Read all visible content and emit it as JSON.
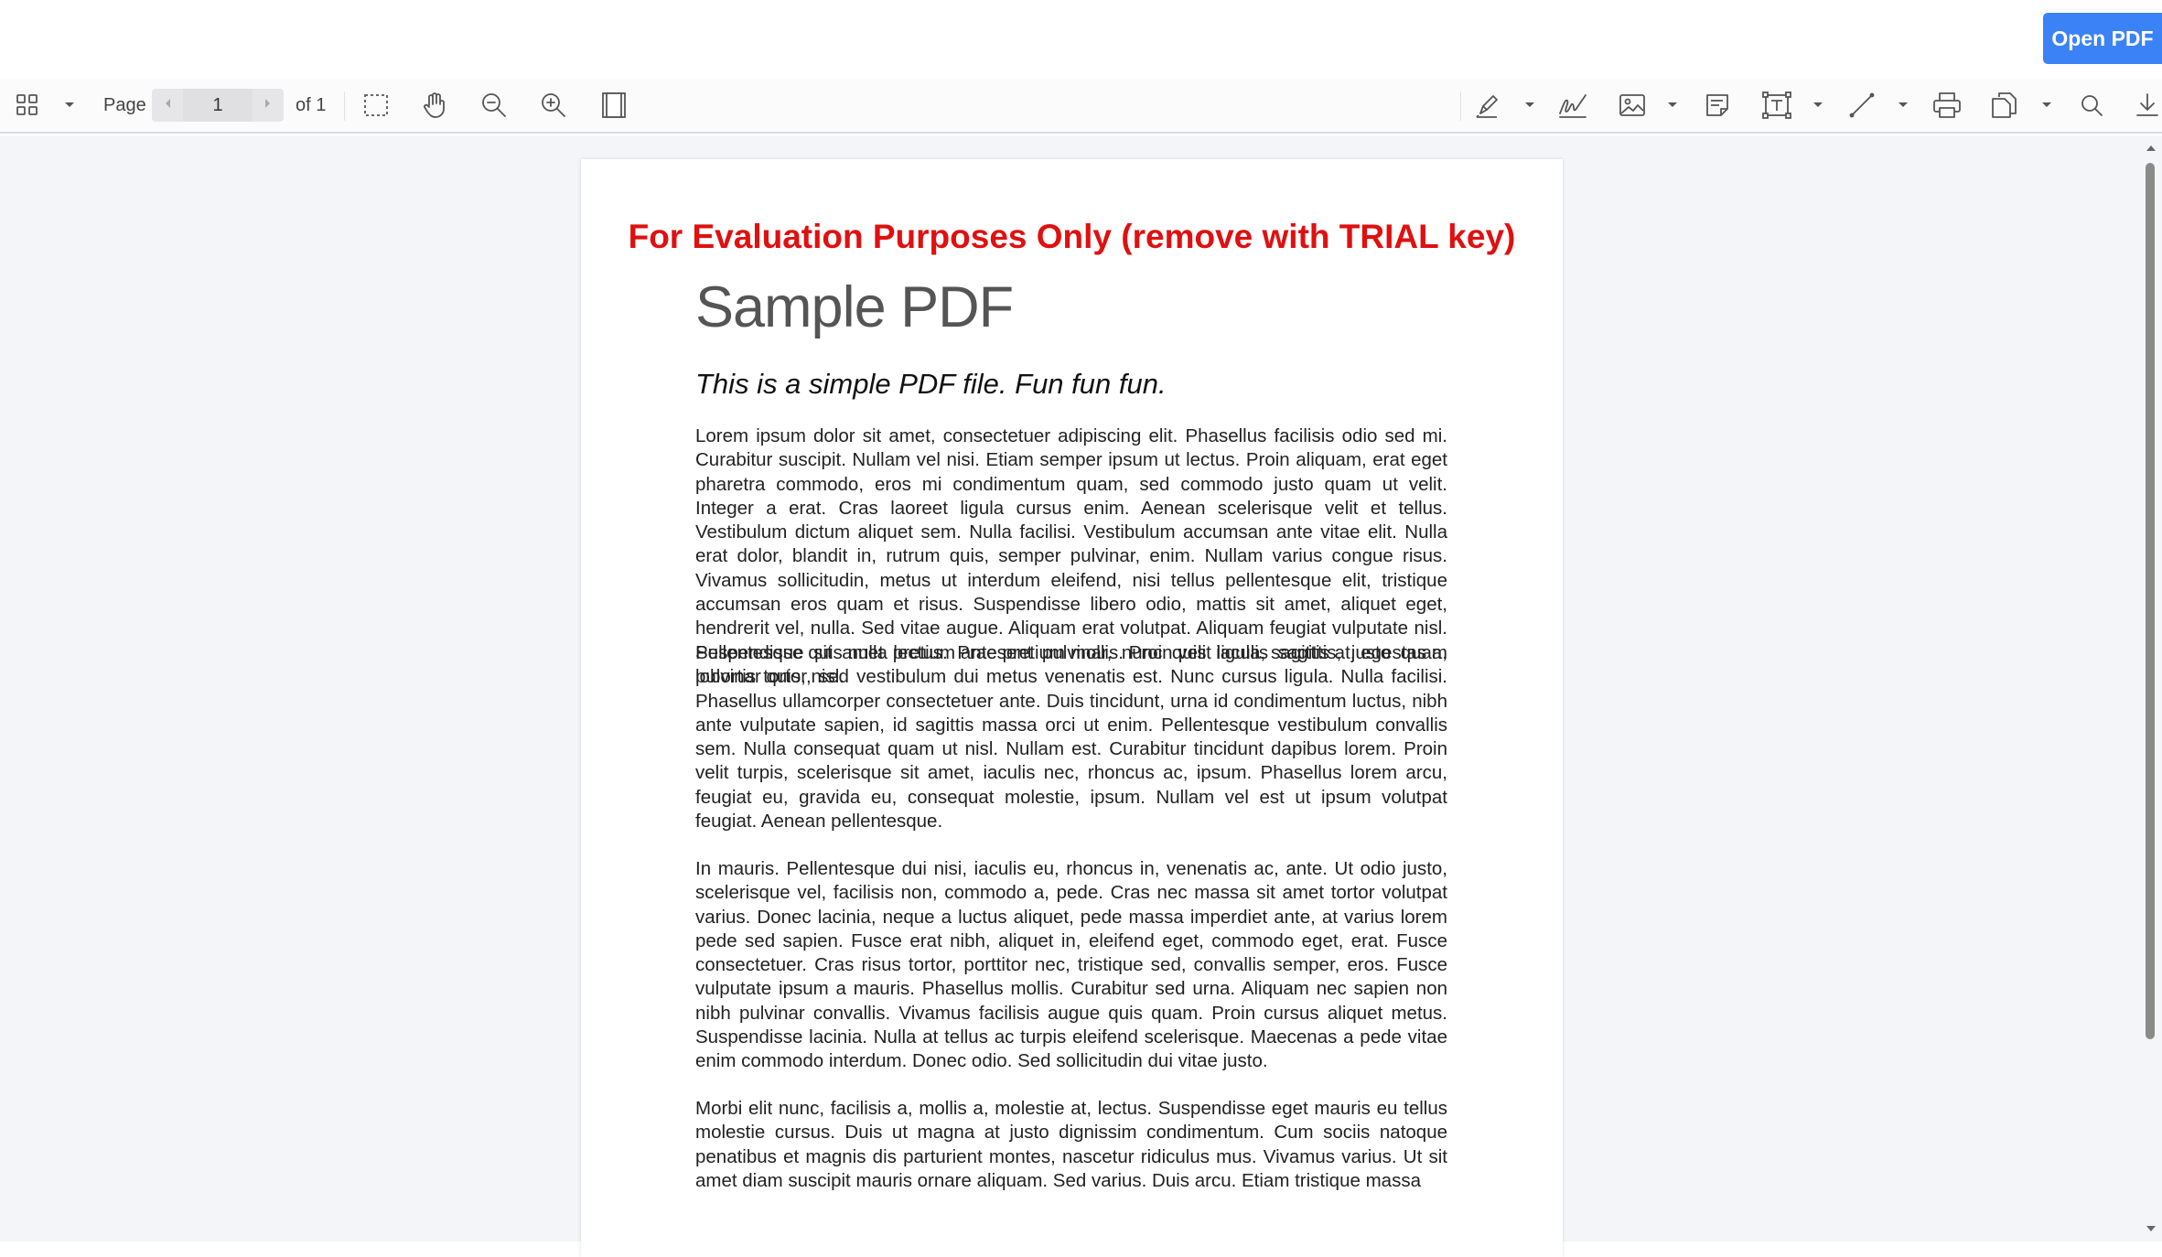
{
  "header": {
    "open_pdf_label": "Open PDF"
  },
  "toolbar": {
    "page_label": "Page",
    "page_number": "1",
    "page_total": "of 1",
    "accent_color": "#3b82f6"
  },
  "icons": [
    "thumbnails-grid-icon",
    "chevron-down-icon",
    "chevron-left-icon",
    "chevron-right-icon",
    "marquee-select-icon",
    "hand-pan-icon",
    "zoom-out-icon",
    "zoom-in-icon",
    "fit-page-icon",
    "highlighter-icon",
    "signature-icon",
    "image-icon",
    "sticky-note-icon",
    "text-box-icon",
    "line-icon",
    "print-icon",
    "export-icon",
    "search-icon",
    "download-icon"
  ],
  "document": {
    "watermark": "For Evaluation Purposes Only (remove with TRIAL key)",
    "watermark_color": "#e01010",
    "title": "Sample PDF",
    "subtitle": "This is a simple PDF file. Fun fun fun.",
    "paragraphs": [
      "Lorem ipsum dolor sit amet, consectetuer adipiscing elit. Phasellus facilisis odio sed mi. Curabitur suscipit. Nullam vel nisi. Etiam semper ipsum ut lectus. Proin aliquam, erat eget pharetra commodo, eros mi condimentum quam, sed commodo justo quam ut velit. Integer a erat. Cras laoreet ligula cursus enim. Aenean scelerisque velit et tellus. Vestibulum dictum aliquet sem. Nulla facilisi. Vestibulum accumsan ante vitae elit. Nulla erat dolor, blandit in, rutrum quis, semper pulvinar, enim. Nullam varius congue risus. Vivamus sollicitudin, metus ut interdum eleifend, nisi tellus pellentesque elit, tristique accumsan eros quam et risus. Suspendisse libero odio, mattis sit amet, aliquet eget, hendrerit vel, nulla. Sed vitae augue. Aliquam erat volutpat. Aliquam feugiat vulputate nisl. Suspendisse quis nulla pretium ante pretium mollis. Proin velit ligula, sagittis at, egestas a, pulvinar quis, nisl.",
      "Pellentesque sit amet lectus. Praesent pulvinar, nunc quis iaculis sagittis, justo quam lobortis tortor, sed vestibulum dui metus venenatis est. Nunc cursus ligula. Nulla facilisi. Phasellus ullamcorper consectetuer ante. Duis tincidunt, urna id condimentum luctus, nibh ante vulputate sapien, id sagittis massa orci ut enim. Pellentesque vestibulum convallis sem. Nulla consequat quam ut nisl. Nullam est. Curabitur tincidunt dapibus lorem. Proin velit turpis, scelerisque sit amet, iaculis nec, rhoncus ac, ipsum. Phasellus lorem arcu, feugiat eu, gravida eu, consequat molestie, ipsum. Nullam vel est ut ipsum volutpat feugiat. Aenean pellentesque.",
      "In mauris. Pellentesque dui nisi, iaculis eu, rhoncus in, venenatis ac, ante. Ut odio justo, scelerisque vel, facilisis non, commodo a, pede. Cras nec massa sit amet tortor volutpat varius. Donec lacinia, neque a luctus aliquet, pede massa imperdiet ante, at varius lorem pede sed sapien. Fusce erat nibh, aliquet in, eleifend eget, commodo eget, erat. Fusce consectetuer. Cras risus tortor, porttitor nec, tristique sed, convallis semper, eros. Fusce vulputate ipsum a mauris. Phasellus mollis. Curabitur sed urna. Aliquam nec sapien non nibh pulvinar convallis. Vivamus facilisis augue quis quam. Proin cursus aliquet metus. Suspendisse lacinia. Nulla at tellus ac turpis eleifend scelerisque. Maecenas a pede vitae enim commodo interdum. Donec odio. Sed sollicitudin dui vitae justo.",
      "Morbi elit nunc, facilisis a, mollis a, molestie at, lectus. Suspendisse eget mauris eu tellus molestie cursus. Duis ut magna at justo dignissim condimentum. Cum sociis natoque penatibus et magnis dis parturient montes, nascetur ridiculus mus. Vivamus varius. Ut sit amet diam suscipit mauris ornare aliquam. Sed varius. Duis arcu. Etiam tristique massa"
    ]
  }
}
